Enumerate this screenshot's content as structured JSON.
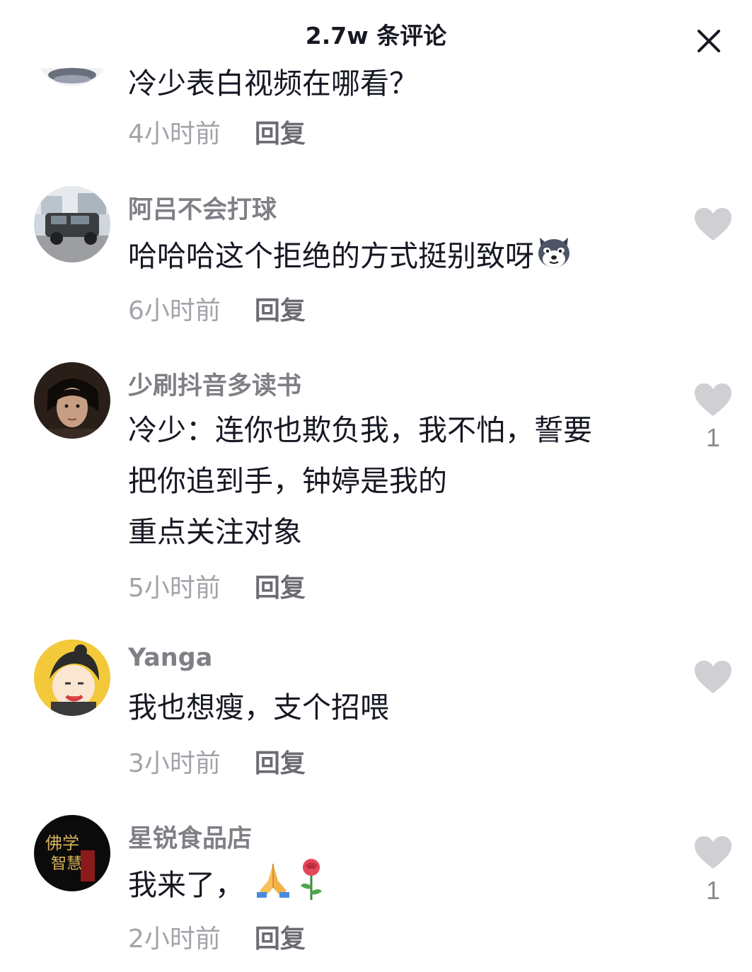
{
  "header": {
    "title": "2.7w 条评论"
  },
  "comments": [
    {
      "text_lines": [
        "冷少表白视频在哪看？"
      ],
      "time": "4小时前",
      "reply": "回复"
    },
    {
      "username": "阿吕不会打球",
      "text_lines": [
        "哈哈哈这个拒绝的方式挺别致呀"
      ],
      "time": "6小时前",
      "reply": "回复",
      "likes": ""
    },
    {
      "username": "少刷抖音多读书",
      "text_lines": [
        "冷少：连你也欺负我，我不怕，誓要",
        "把你追到手，钟婷是我的",
        "重点关注对象"
      ],
      "time": "5小时前",
      "reply": "回复",
      "likes": "1"
    },
    {
      "username": "Yanga",
      "text_lines": [
        "我也想瘦，支个招喂"
      ],
      "time": "3小时前",
      "reply": "回复",
      "likes": ""
    },
    {
      "username": "星锐食品店",
      "text_lines": [
        "我来了，"
      ],
      "time": "2小时前",
      "reply": "回复",
      "likes": "1",
      "avatar_text": [
        "佛学",
        "智慧"
      ]
    }
  ],
  "icons": {
    "close": "close-icon",
    "like": "heart-icon",
    "emoji_dog": "dog-face-emoji-icon",
    "emoji_pray": "folded-hands-emoji-icon",
    "emoji_rose": "rose-emoji-icon"
  },
  "colors": {
    "text": "#161823",
    "username": "#7f7f86",
    "time": "#a3a3aa",
    "heart": "#d0d0d4"
  }
}
